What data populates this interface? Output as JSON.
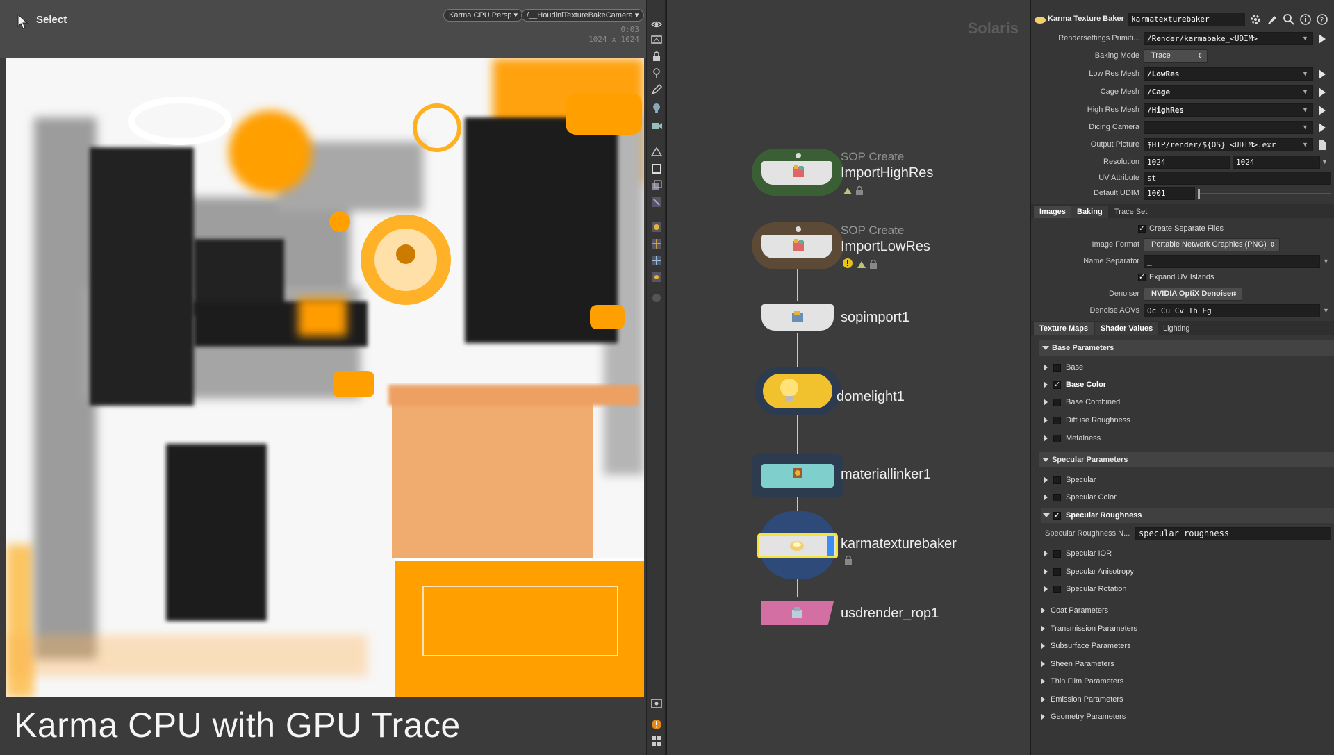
{
  "viewport": {
    "tool_mode": "Select",
    "camera_menu": "Karma CPU Persp",
    "camera_path_menu": "/__HoudiniTextureBakeCamera",
    "render_time": "0:03",
    "resolution_readout": "1024 x 1024",
    "caption": "Karma CPU with GPU Trace"
  },
  "network": {
    "context_label": "Solaris",
    "nodes": [
      {
        "type": "SOP Create",
        "name": "ImportHighRes",
        "color": "#3b5f34"
      },
      {
        "type": "SOP Create",
        "name": "ImportLowRes",
        "color": "#5c4a36"
      },
      {
        "type": "",
        "name": "sopimport1",
        "color": ""
      },
      {
        "type": "",
        "name": "domelight1",
        "color": "#f2c22e"
      },
      {
        "type": "",
        "name": "materiallinker1",
        "color": "#7fd0cc"
      },
      {
        "type": "",
        "name": "karmatexturebaker",
        "color": "#e3e3e3"
      },
      {
        "type": "",
        "name": "usdrender_rop1",
        "color": "#d46fa3"
      }
    ]
  },
  "params": {
    "node_type": "Karma Texture Baker",
    "node_name": "karmatexturebaker",
    "fields": [
      {
        "label": "Rendersettings Primiti...",
        "value": "/Render/karmabake_<UDIM>"
      },
      {
        "label": "Baking Mode",
        "value": "Trace"
      },
      {
        "label": "Low Res Mesh",
        "value": "/LowRes"
      },
      {
        "label": "Cage Mesh",
        "value": "/Cage"
      },
      {
        "label": "High Res Mesh",
        "value": "/HighRes"
      },
      {
        "label": "Dicing Camera",
        "value": ""
      },
      {
        "label": "Output Picture",
        "value": "$HIP/render/${OS}_<UDIM>.exr"
      },
      {
        "label": "Resolution",
        "value": "1024",
        "value2": "1024"
      },
      {
        "label": "UV Attribute",
        "value": "st"
      },
      {
        "label": "Default UDIM",
        "value": "1001"
      }
    ],
    "tabs1": [
      "Images",
      "Baking",
      "Trace Set"
    ],
    "images": {
      "create_separate_files": "Create Separate Files",
      "image_format_label": "Image Format",
      "image_format": "Portable Network Graphics (PNG)",
      "name_separator_label": "Name Separator",
      "name_separator": "_",
      "expand_uv_islands": "Expand UV Islands",
      "denoiser_label": "Denoiser",
      "denoiser": "NVIDIA OptiX Denoiser",
      "denoise_aovs_label": "Denoise AOVs",
      "denoise_aovs": "Oc Cu Cv Th Eg"
    },
    "tabs2": [
      "Texture Maps",
      "Shader Values",
      "Lighting"
    ],
    "base_section": "Base Parameters",
    "base_items": [
      {
        "label": "Base",
        "checked": false
      },
      {
        "label": "Base Color",
        "checked": true
      },
      {
        "label": "Base Combined",
        "checked": false
      },
      {
        "label": "Diffuse Roughness",
        "checked": false
      },
      {
        "label": "Metalness",
        "checked": false
      }
    ],
    "specular_section": "Specular Parameters",
    "specular_items_a": [
      {
        "label": "Specular",
        "checked": false
      },
      {
        "label": "Specular Color",
        "checked": false
      },
      {
        "label": "Specular Roughness",
        "checked": true
      }
    ],
    "spec_rough_name_label": "Specular Roughness N...",
    "spec_rough_name_value": "specular_roughness",
    "specular_items_b": [
      {
        "label": "Specular IOR",
        "checked": false
      },
      {
        "label": "Specular Anisotropy",
        "checked": false
      },
      {
        "label": "Specular Rotation",
        "checked": false
      }
    ],
    "collapsed_sections": [
      "Coat Parameters",
      "Transmission Parameters",
      "Subsurface Parameters",
      "Sheen Parameters",
      "Thin Film Parameters",
      "Emission Parameters",
      "Geometry Parameters"
    ]
  }
}
